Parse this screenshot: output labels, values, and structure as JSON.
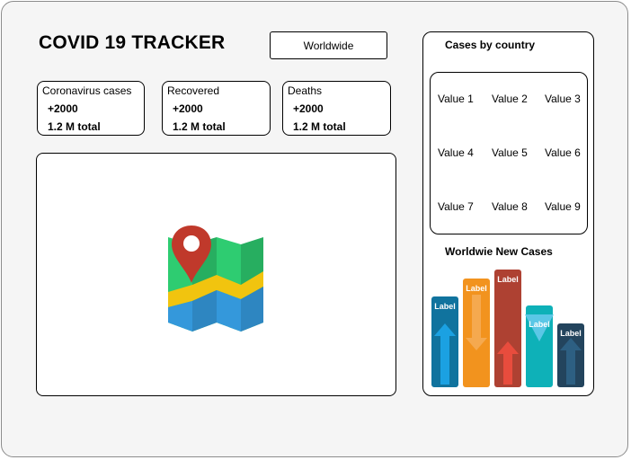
{
  "header": {
    "title": "COVID 19 TRACKER",
    "region_button": "Worldwide"
  },
  "stats": [
    {
      "label": "Coronavirus cases",
      "today": "+2000",
      "total": "1.2 M total"
    },
    {
      "label": "Recovered",
      "today": "+2000",
      "total": "1.2 M total"
    },
    {
      "label": "Deaths",
      "today": "+2000",
      "total": "1.2 M total"
    }
  ],
  "sidebar": {
    "cases_title": "Cases by country",
    "values": [
      "Value 1",
      "Value 2",
      "Value 3",
      "Value 4",
      "Value 5",
      "Value 6",
      "Value 7",
      "Value 8",
      "Value 9"
    ],
    "chart_title": "Worldwie New Cases"
  },
  "chart": {
    "labels": [
      "Label",
      "Label",
      "Label",
      "Label",
      "Label"
    ],
    "directions": [
      "up",
      "down",
      "up",
      "down",
      "up"
    ],
    "colors": [
      "#10739e",
      "#f2931e",
      "#ae4132",
      "#23a6b5",
      "#23445d"
    ]
  },
  "icons": {
    "map": "map-pin-icon"
  }
}
